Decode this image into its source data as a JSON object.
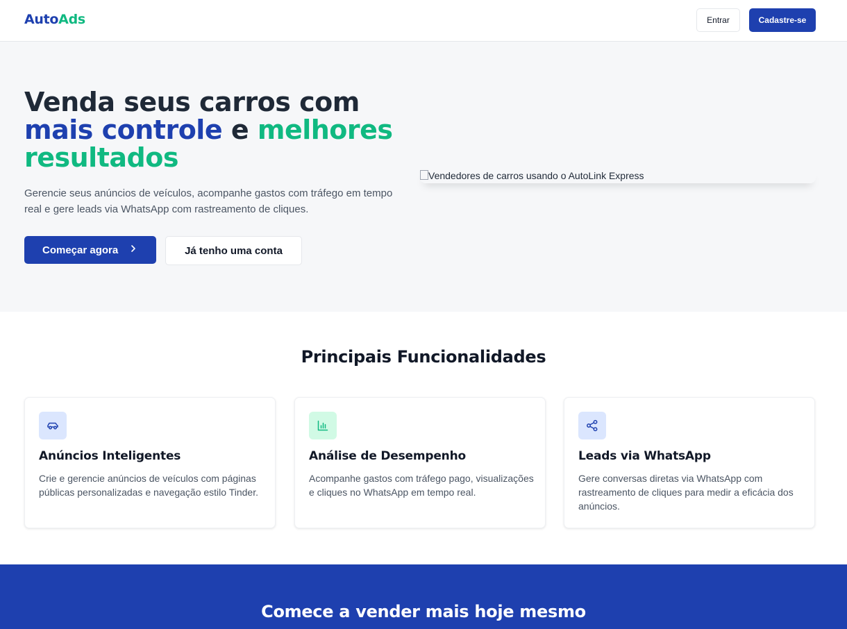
{
  "header": {
    "logo_part1": "Auto",
    "logo_part2": "Ads",
    "login_label": "Entrar",
    "signup_label": "Cadastre-se"
  },
  "hero": {
    "title_line1": "Venda seus carros com",
    "title_highlight_blue": "mais controle",
    "title_connector": " e ",
    "title_highlight_green": "melhores resultados",
    "subtitle": "Gerencie seus anúncios de veículos, acompanhe gastos com tráfego em tempo real e gere leads via WhatsApp com rastreamento de cliques.",
    "start_button": "Começar agora",
    "have_account_button": "Já tenho uma conta",
    "image_alt": "Vendedores de carros usando o AutoLink Express"
  },
  "features": {
    "title": "Principais Funcionalidades",
    "cards": [
      {
        "icon": "car-icon",
        "title": "Anúncios Inteligentes",
        "text": "Crie e gerencie anúncios de veículos com páginas públicas personalizadas e navegação estilo Tinder."
      },
      {
        "icon": "bar-chart-icon",
        "title": "Análise de Desempenho",
        "text": "Acompanhe gastos com tráfego pago, visualizações e cliques no WhatsApp em tempo real."
      },
      {
        "icon": "share-icon",
        "title": "Leads via WhatsApp",
        "text": "Gere conversas diretas via WhatsApp com rastreamento de cliques para medir a eficácia dos anúncios."
      }
    ]
  },
  "cta": {
    "title": "Comece a vender mais hoje mesmo"
  },
  "colors": {
    "primary": "#1e40af",
    "accent_green": "#10b981",
    "hero_bg": "#f6f7f9"
  }
}
